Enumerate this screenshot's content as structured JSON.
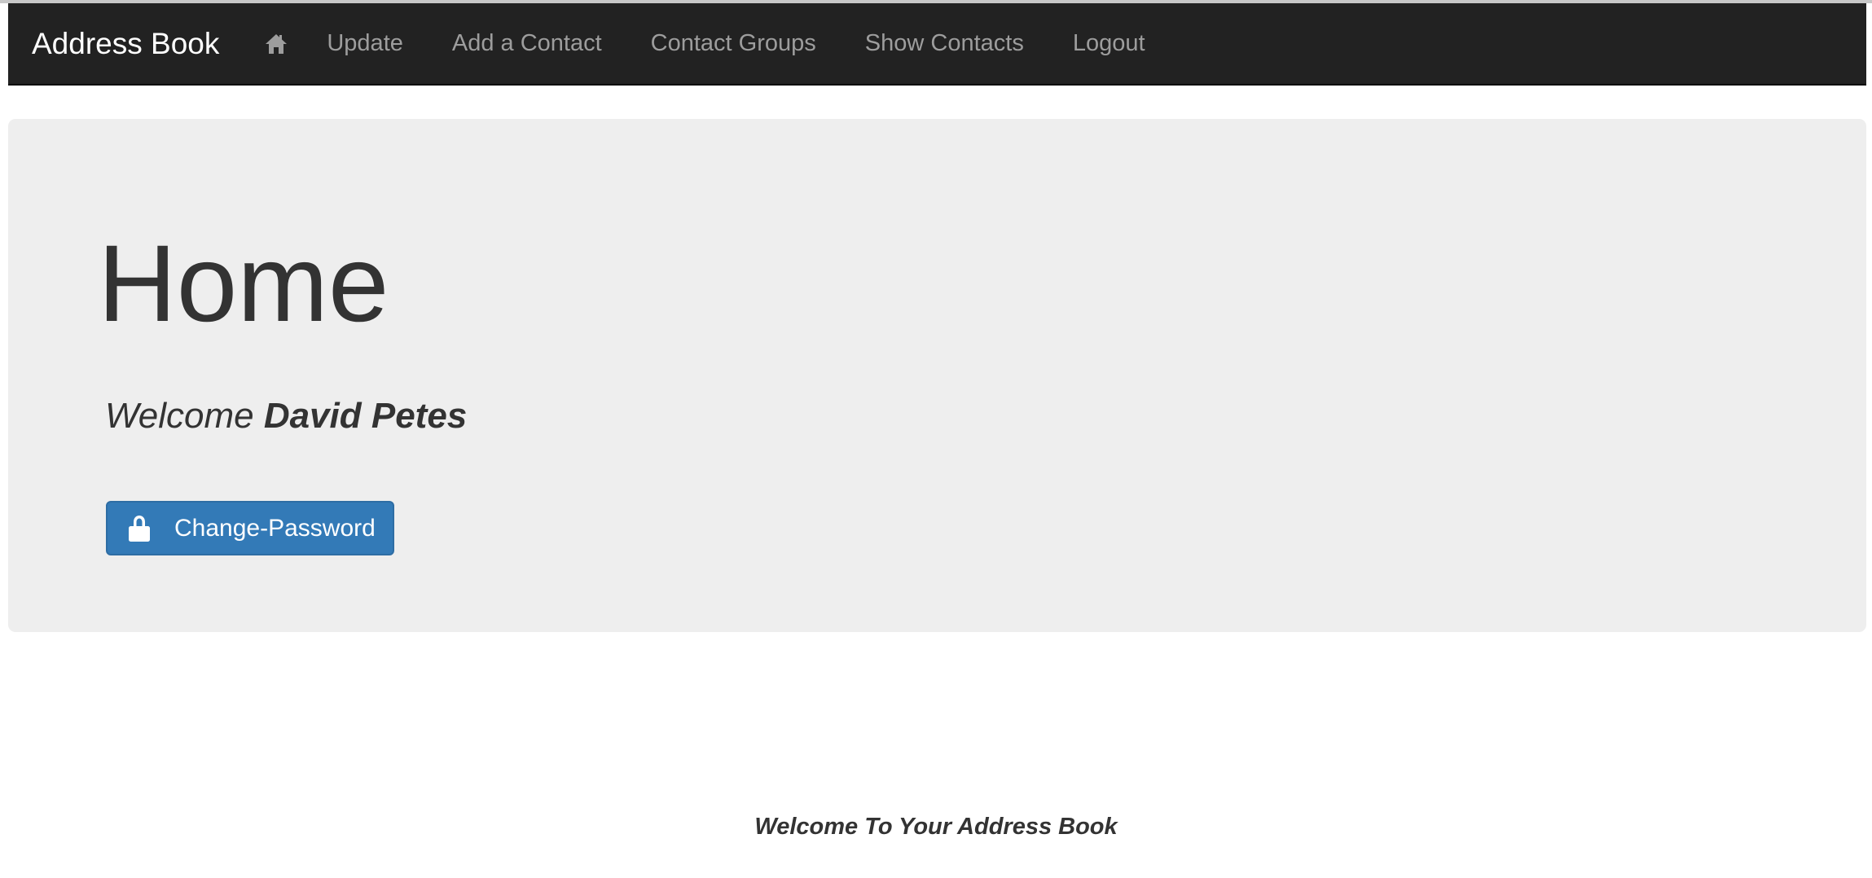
{
  "navbar": {
    "brand": "Address Book",
    "home_icon": "home-icon",
    "links": [
      "Update",
      "Add a Contact",
      "Contact Groups",
      "Show Contacts",
      "Logout"
    ]
  },
  "main": {
    "title": "Home",
    "welcome_prefix": "Welcome",
    "user_name": "David Petes",
    "change_password_label": "Change-Password",
    "change_password_icon": "lock-icon"
  },
  "footer": {
    "text": "Welcome To Your Address Book"
  },
  "colors": {
    "navbar_bg": "#222222",
    "jumbotron_bg": "#eeeeee",
    "button_primary": "#337ab7"
  }
}
